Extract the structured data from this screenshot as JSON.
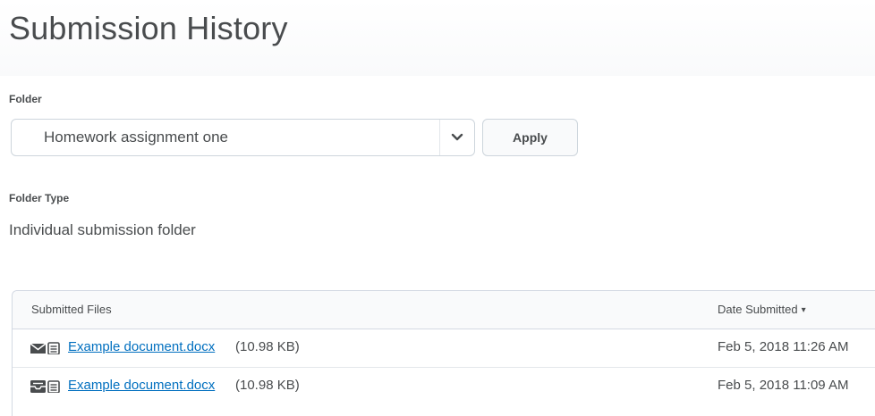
{
  "page": {
    "title": "Submission History"
  },
  "folder": {
    "label": "Folder",
    "selected_value": "Homework assignment one",
    "apply_label": "Apply"
  },
  "folder_type": {
    "label": "Folder Type",
    "value": "Individual submission folder"
  },
  "table": {
    "columns": {
      "submitted_files": "Submitted Files",
      "date_submitted": "Date Submitted",
      "sort_indicator": "▾"
    },
    "rows": [
      {
        "file_name": "Example document.docx",
        "file_size": "(10.98 KB)",
        "date": "Feb 5, 2018 11:26 AM",
        "icon_primary": "envelope-icon"
      },
      {
        "file_name": "Example document.docx",
        "file_size": "(10.98 KB)",
        "date": "Feb 5, 2018 11:09 AM",
        "icon_primary": "inbox-tray-icon"
      }
    ]
  },
  "colors": {
    "text": "#494c4e",
    "link": "#006fbf",
    "border": "#cdd5dc",
    "header_bg": "#f9fafb"
  }
}
